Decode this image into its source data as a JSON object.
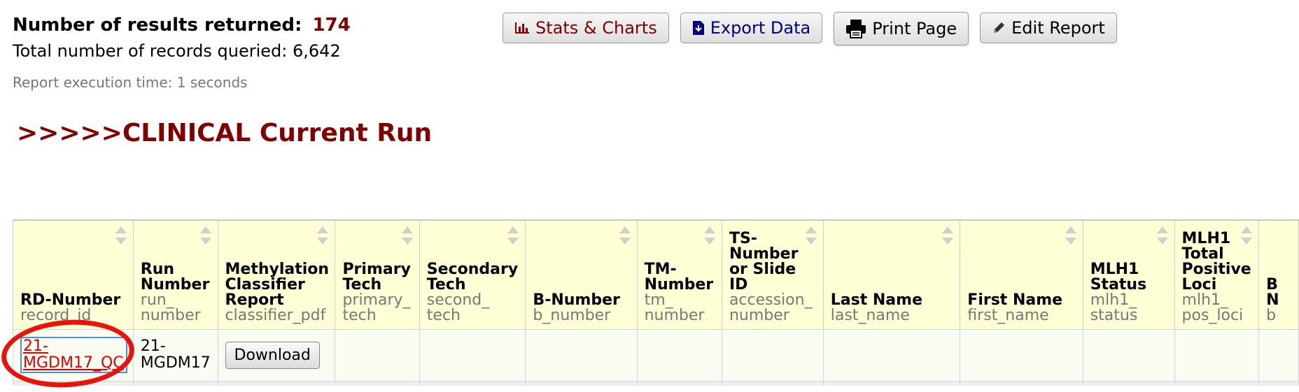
{
  "summary": {
    "results_label": "Number of results returned:",
    "results_count": "174",
    "records_label": "Total number of records queried:",
    "records_count": "6,642",
    "execution_time": "Report execution time: 1 seconds"
  },
  "toolbar": {
    "stats_label": "Stats & Charts",
    "export_label": "Export Data",
    "print_label": "Print Page",
    "edit_label": "Edit Report"
  },
  "report_title": ">>>>>CLINICAL Current Run",
  "table": {
    "columns": [
      {
        "label": "RD-Number",
        "var": "record_id"
      },
      {
        "label": "Run Number",
        "var": "run_ number"
      },
      {
        "label": "Methylation Classifier Report",
        "var": "classifier_pdf"
      },
      {
        "label": "Primary Tech",
        "var": "primary_ tech"
      },
      {
        "label": "Secondary Tech",
        "var": "second_ tech"
      },
      {
        "label": "B-Number",
        "var": "b_number"
      },
      {
        "label": "TM- Number",
        "var": "tm_ number"
      },
      {
        "label": "TS- Number or Slide ID",
        "var": "accession_ number"
      },
      {
        "label": "Last Name",
        "var": "last_name"
      },
      {
        "label": "First Name",
        "var": "first_name"
      },
      {
        "label": "MLH1 Status",
        "var": "mlh1_ status"
      },
      {
        "label": "MLH1 Total Positive Loci",
        "var": "mlh1_ pos_loci"
      },
      {
        "label": "B N",
        "var": "b"
      }
    ],
    "rows": [
      {
        "record_id": "21- MGDM17_QC",
        "run_number": "21- MGDM17",
        "download_label": "Download"
      }
    ]
  },
  "icons": {
    "stats": "bar-chart-icon",
    "export": "file-download-icon",
    "print": "printer-icon",
    "edit": "pencil-icon"
  },
  "colors": {
    "accent": "#800000",
    "header_bg": "#ffffd5",
    "link": "#e00000",
    "annotation": "#e8130a"
  }
}
